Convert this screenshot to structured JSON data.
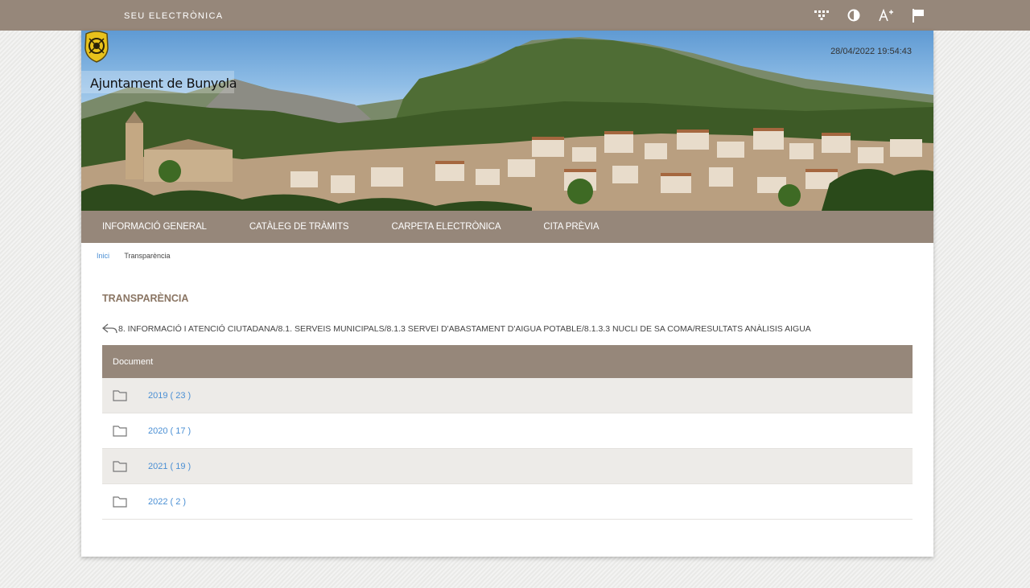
{
  "topbar": {
    "brand": "SEU ELECTRÒNICA",
    "tools": [
      {
        "icon": "keyboard-dots-icon"
      },
      {
        "icon": "contrast-icon"
      },
      {
        "icon": "font-size-increase-icon"
      },
      {
        "icon": "flag-icon"
      }
    ]
  },
  "header": {
    "council_name": "Ajuntament de Bunyola",
    "datetime": "28/04/2022 19:54:43"
  },
  "nav": {
    "items": [
      {
        "label": "INFORMACIÓ GENERAL"
      },
      {
        "label": "CATÀLEG DE TRÀMITS"
      },
      {
        "label": "CARPETA ELECTRÒNICA"
      },
      {
        "label": "CITA PRÈVIA"
      }
    ]
  },
  "breadcrumb": {
    "home": "Inici",
    "current": "Transparència"
  },
  "page": {
    "title": "TRANSPARÈNCIA",
    "path": "8. INFORMACIÓ I ATENCIÓ CIUTADANA/8.1. SERVEIS MUNICIPALS/8.1.3 SERVEI D'ABASTAMENT D'AIGUA POTABLE/8.1.3.3 NUCLI DE SA COMA/RESULTATS ANÀLISIS AIGUA"
  },
  "table": {
    "header": "Document",
    "rows": [
      {
        "label": "2019 ( 23 )"
      },
      {
        "label": "2020 ( 17 )"
      },
      {
        "label": "2021 ( 19 )"
      },
      {
        "label": "2022 ( 2 )"
      }
    ]
  }
}
